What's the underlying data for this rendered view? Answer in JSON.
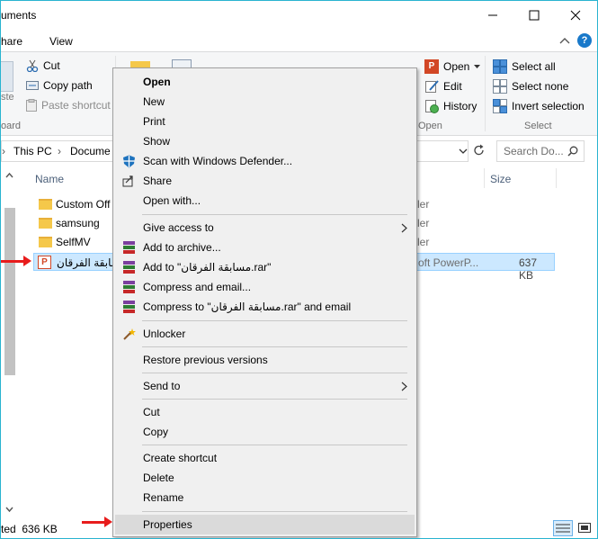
{
  "window": {
    "title": "uments"
  },
  "tabs": {
    "share": "hare",
    "view": "View"
  },
  "ribbon": {
    "clipboard": {
      "cut": "Cut",
      "copy_path": "Copy path",
      "paste_shortcut": "Paste shortcut",
      "paste_partial": "ste",
      "group_label": "oard"
    },
    "open": {
      "open": "Open",
      "edit": "Edit",
      "history": "History",
      "group_label": "Open"
    },
    "select": {
      "select_all": "Select all",
      "select_none": "Select none",
      "invert": "Invert selection",
      "group_label": "Select"
    }
  },
  "address": {
    "this_pc": "This PC",
    "documents": "Docume",
    "search_placeholder": "Search Do..."
  },
  "columns": {
    "name": "Name",
    "size": "Size"
  },
  "files": [
    {
      "name": "Custom Off",
      "type_partial": "ler"
    },
    {
      "name": "samsung",
      "type_partial": "ler"
    },
    {
      "name": "SelfMV",
      "type_partial": "ler"
    },
    {
      "name": "مسابقة الفرقان",
      "type_partial": "oft PowerP...",
      "size": "637 KB"
    }
  ],
  "status": {
    "selected": "ted  636 KB"
  },
  "context_menu": {
    "open": "Open",
    "new": "New",
    "print": "Print",
    "show": "Show",
    "scan": "Scan with Windows Defender...",
    "share": "Share",
    "open_with": "Open with...",
    "give_access": "Give access to",
    "add_archive": "Add to archive...",
    "add_to_rar": "Add to \"مسابقة الفرقان.rar\"",
    "compress_email": "Compress and email...",
    "compress_rar_email": "Compress to \"مسابقة الفرقان.rar\" and email",
    "unlocker": "Unlocker",
    "restore": "Restore previous versions",
    "send_to": "Send to",
    "cut": "Cut",
    "copy": "Copy",
    "create_shortcut": "Create shortcut",
    "delete": "Delete",
    "rename": "Rename",
    "properties": "Properties"
  },
  "colors": {
    "accent": "#29b4d0",
    "selection": "#cce8ff",
    "arrow": "#e81c1c"
  }
}
